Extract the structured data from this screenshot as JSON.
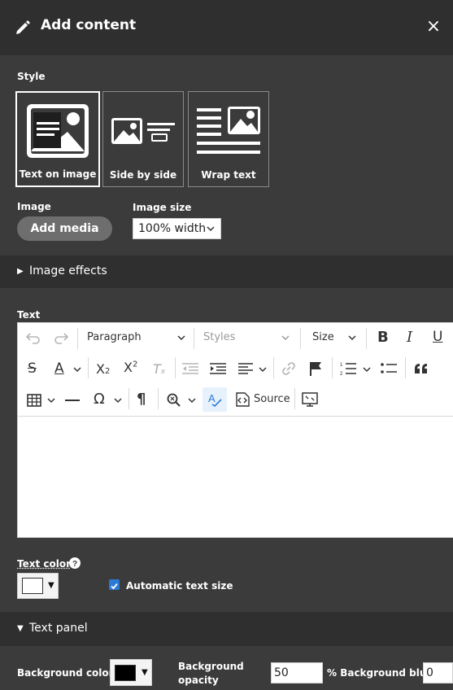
{
  "header": {
    "title": "Add content",
    "close_label": "×"
  },
  "style": {
    "label": "Style",
    "options": [
      {
        "label": "Text on image",
        "selected": true,
        "icon": "text-on-image-icon"
      },
      {
        "label": "Side by side",
        "selected": false,
        "icon": "side-by-side-icon"
      },
      {
        "label": "Wrap text",
        "selected": false,
        "icon": "wrap-text-icon"
      }
    ]
  },
  "image": {
    "label": "Image",
    "add_media_label": "Add media"
  },
  "image_size": {
    "label": "Image size",
    "value": "100% width"
  },
  "image_effects": {
    "label": "Image effects",
    "expanded": false
  },
  "text": {
    "label": "Text",
    "toolbar": {
      "block_format": "Paragraph",
      "styles": "Styles",
      "size": "Size",
      "source_label": "Source",
      "icons": [
        "undo-icon",
        "redo-icon",
        "bold-icon",
        "italic-icon",
        "underline-icon",
        "strikethrough-icon",
        "font-color-icon",
        "subscript-icon",
        "superscript-icon",
        "remove-format-icon",
        "outdent-icon",
        "indent-icon",
        "align-icon",
        "link-icon",
        "anchor-flag-icon",
        "numbered-list-icon",
        "bulleted-list-icon",
        "blockquote-icon",
        "table-icon",
        "horizontal-line-icon",
        "special-character-icon",
        "show-blocks-icon",
        "find-replace-icon",
        "spellcheck-icon",
        "source-icon",
        "maximize-icon"
      ]
    },
    "content": ""
  },
  "text_color": {
    "label": "Text color",
    "help_icon": "help-icon",
    "value": "#ffffff"
  },
  "automatic_text_size": {
    "label": "Automatic text size",
    "checked": true
  },
  "text_panel": {
    "label": "Text panel",
    "expanded": true
  },
  "background": {
    "color_label": "Background color",
    "color_value": "#000000",
    "opacity_label": "Background opacity",
    "opacity_value": "50",
    "blur_label": "% Background blur",
    "blur_value": "0"
  },
  "colors": {
    "header_bg": "#2f2f2f",
    "panel_bg": "#3b3b3b",
    "button_bg": "#6e6e6e",
    "check_blue": "#2d7ad6",
    "active_tool": "#e6f1fc"
  }
}
